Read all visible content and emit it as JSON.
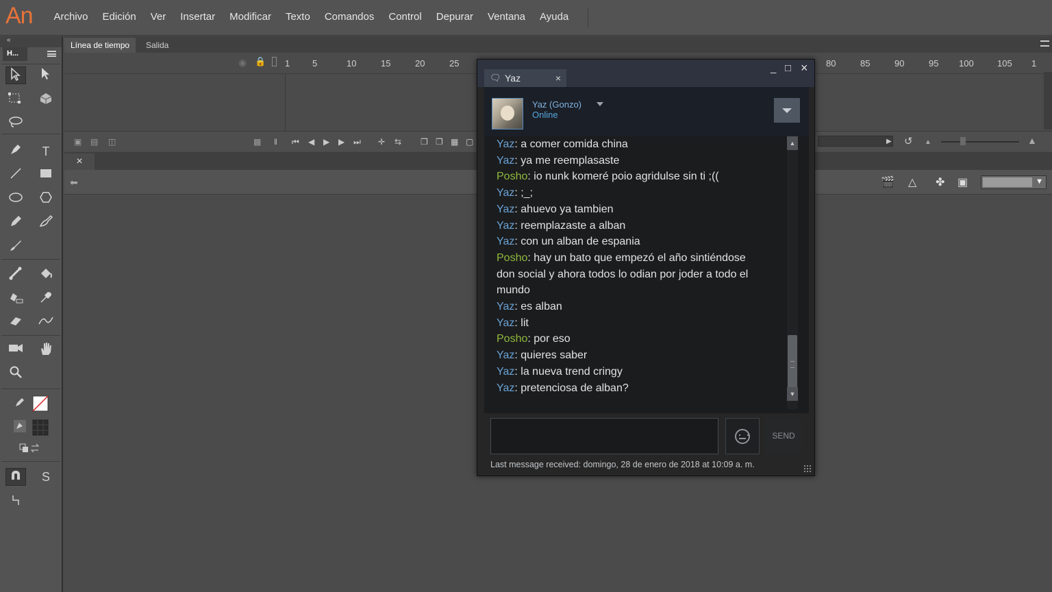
{
  "app": {
    "logo": "An"
  },
  "menu": [
    "Archivo",
    "Edición",
    "Ver",
    "Insertar",
    "Modificar",
    "Texto",
    "Comandos",
    "Control",
    "Depurar",
    "Ventana",
    "Ayuda"
  ],
  "tools_panel": {
    "collapse": "«",
    "tab": "H...",
    "text_tool_label": "T",
    "bone_label": "S"
  },
  "timeline": {
    "tabs": [
      "Línea de tiempo",
      "Salida"
    ],
    "frame_numbers": [
      "1",
      "5",
      "10",
      "15",
      "20",
      "25",
      "80",
      "85",
      "90",
      "95",
      "100",
      "105",
      "1"
    ]
  },
  "stage": {
    "close_label": "×"
  },
  "chat": {
    "tab_name": "Yaz",
    "tab_close": "×",
    "window_buttons": {
      "min": "_",
      "max": "□",
      "close": "×"
    },
    "friend_name": "Yaz (Gonzo)",
    "friend_status": "Online",
    "messages": [
      {
        "who": "Yaz",
        "text": ": a comer comida china"
      },
      {
        "who": "Yaz",
        "text": ": ya me reemplasaste"
      },
      {
        "who": "Posho",
        "text": ": io nunk komeré poio agridulse sin ti ;(("
      },
      {
        "who": "Yaz",
        "text": ": ;_;"
      },
      {
        "who": "Yaz",
        "text": ": ahuevo ya tambien"
      },
      {
        "who": "Yaz",
        "text": ": reemplazaste a alban"
      },
      {
        "who": "Yaz",
        "text": ": con un alban de espania"
      },
      {
        "who": "Posho",
        "text": ": hay un bato que empezó el año sintiéndose don social y ahora todos lo odian por joder a todo el mundo"
      },
      {
        "who": "Yaz",
        "text": ": es alban"
      },
      {
        "who": "Yaz",
        "text": ": lit"
      },
      {
        "who": "Posho",
        "text": ": por eso"
      },
      {
        "who": "Yaz",
        "text": ": quieres saber"
      },
      {
        "who": "Yaz",
        "text": ": la nueva trend cringy"
      },
      {
        "who": "Yaz",
        "text": ": pretenciosa de alban?"
      }
    ],
    "send_label": "SEND",
    "last_message": "Last message received: domingo, 28 de enero de 2018 at 10:09 a. m.",
    "scroll_up": "▲",
    "scroll_down": "▼"
  }
}
